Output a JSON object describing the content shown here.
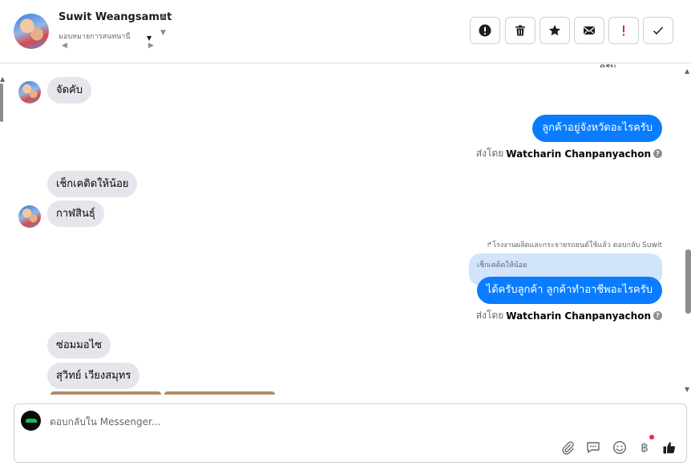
{
  "header": {
    "contact_name": "Suwit Weangsamut",
    "contact_subtitle": "มอบหมายการสนทนานี้",
    "toolbar_buttons": [
      {
        "name": "spam-button",
        "icon": "alert-circle-icon"
      },
      {
        "name": "delete-button",
        "icon": "trash-icon"
      },
      {
        "name": "star-button",
        "icon": "star-icon"
      },
      {
        "name": "unread-button",
        "icon": "envelope-icon"
      },
      {
        "name": "important-button",
        "icon": "exclamation-icon",
        "color": "#e41e3f"
      },
      {
        "name": "done-button",
        "icon": "check-icon"
      }
    ]
  },
  "messages": {
    "m1": "จัดคับ",
    "m2": "ลูกค้าอยู่จังหวัดอะไรครับ",
    "m3": "เช็กเคดิดให้น้อย",
    "m4": "กาฬสินธุ์",
    "m5_reply_header": "โรงงานผลิตและกระจายรถยนต์ใช้แล้ว ตอบกลับ Suwit",
    "m5_quoted": "เช็กเคดิดให้น้อย",
    "m5": "ได้ครับลูกค้า ลูกค้าทำอาชีพอะไรครับ",
    "m6": "ซ่อมมอไซ",
    "m7": "สุวิทย์ เวียงสมุทร",
    "sent_by_prefix": "ส่งโดย",
    "sent_by_name": "Watcharin Chanpanyachon"
  },
  "composer": {
    "placeholder": "ตอบกลับใน Messenger...",
    "icons": [
      "paperclip-icon",
      "saved-reply-icon",
      "emoji-icon",
      "baht-icon",
      "like-icon"
    ]
  },
  "colors": {
    "outgoing_bubble": "#0a7cff",
    "incoming_bubble": "#e4e6eb",
    "quoted_bubble": "#d2e4fb",
    "notification_dot": "#f02849"
  }
}
